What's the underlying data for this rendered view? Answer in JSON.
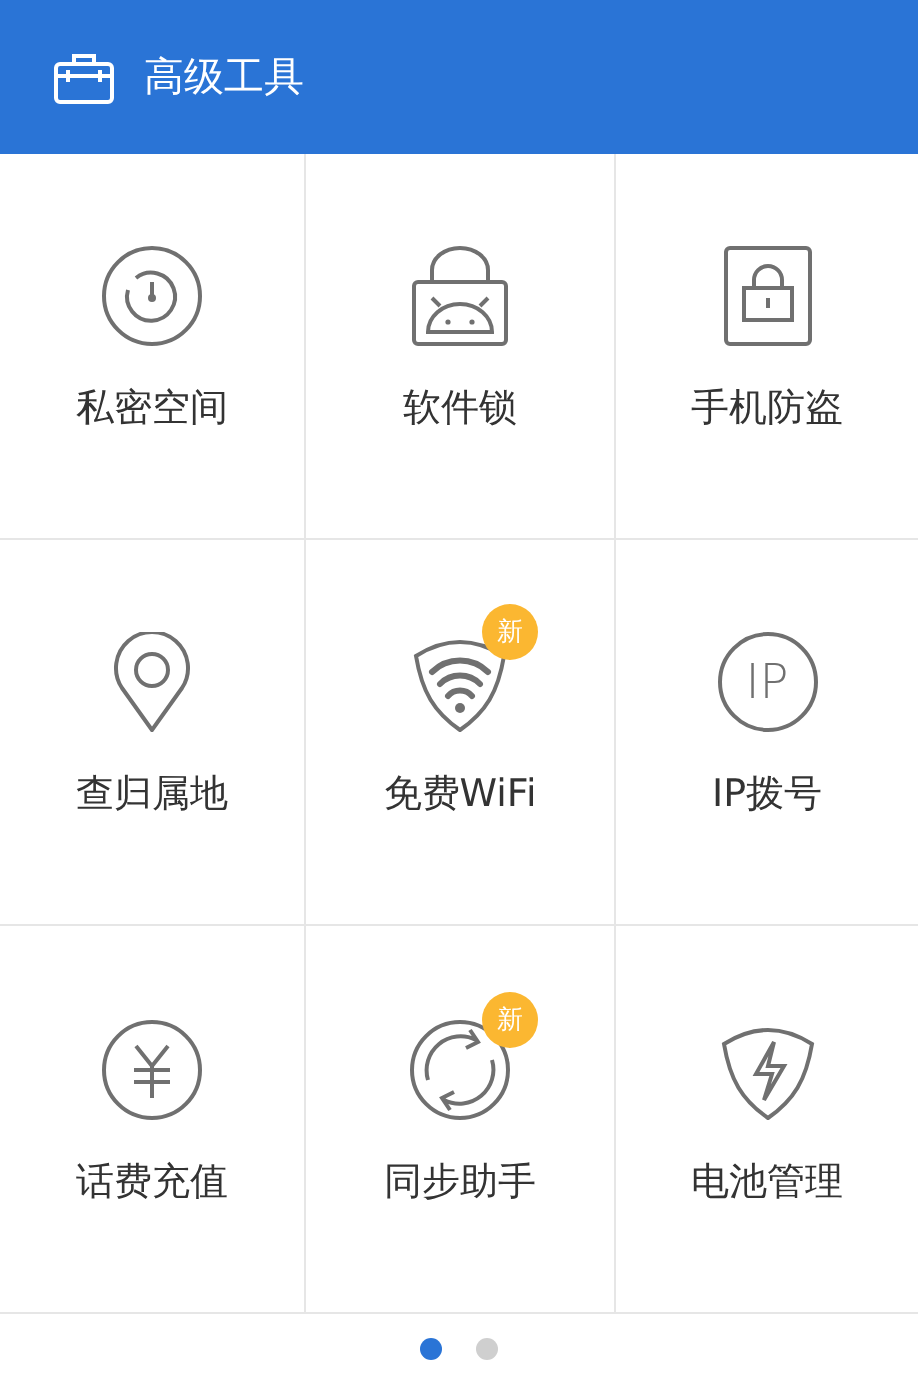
{
  "header": {
    "title": "高级工具"
  },
  "tools": [
    {
      "label": "私密空间"
    },
    {
      "label": "软件锁"
    },
    {
      "label": "手机防盗"
    },
    {
      "label": "查归属地"
    },
    {
      "label": "免费WiFi",
      "badge": "新"
    },
    {
      "label": "IP拨号",
      "icon_text": "IP"
    },
    {
      "label": "话费充值"
    },
    {
      "label": "同步助手",
      "badge": "新"
    },
    {
      "label": "电池管理"
    }
  ],
  "pager": [
    {
      "selected": true
    },
    {
      "selected": false
    }
  ]
}
